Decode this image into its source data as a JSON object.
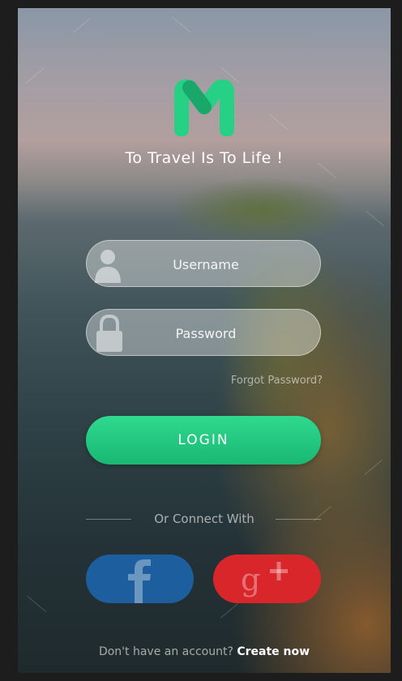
{
  "app": {
    "tagline": "To Travel Is To Life !"
  },
  "icons": {
    "logo": "m-logo-icon",
    "username": "user-icon",
    "password": "lock-icon",
    "facebook": "facebook-icon",
    "google_plus": "google-plus-icon"
  },
  "form": {
    "username_placeholder": "Username",
    "password_placeholder": "Password",
    "forgot_password": "Forgot Password?",
    "login_label": "LOGIN"
  },
  "social": {
    "divider_text": "Or Connect With"
  },
  "footer": {
    "prompt": "Don't have an account?",
    "create_link": "Create now"
  },
  "colors": {
    "accent": "#22c983",
    "facebook": "#1d5e9e",
    "google_plus": "#d9262a",
    "logo": "#26d186"
  }
}
